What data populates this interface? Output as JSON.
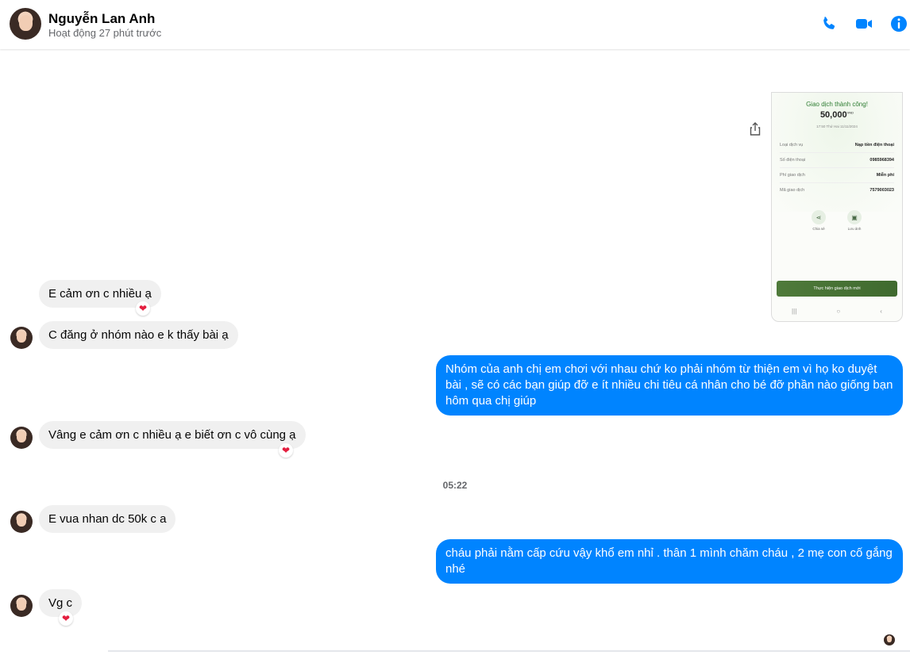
{
  "header": {
    "name": "Nguyễn Lan Anh",
    "status": "Hoạt động 27 phút trước",
    "icons": [
      "phone-icon",
      "video-icon",
      "info-icon"
    ],
    "accent_color": "#0084ff"
  },
  "transfer_image": {
    "title": "Giao dịch thành công!",
    "amount": "50,000",
    "currency": "VND",
    "time": "17:50 Thứ Hai 11/11/2024",
    "rows": [
      {
        "label": "Loại dịch vụ",
        "value": "Nạp tiền điện thoại"
      },
      {
        "label": "Số điện thoại",
        "value": "0985968394"
      },
      {
        "label": "Phí giao dịch",
        "value": "Miễn phí"
      },
      {
        "label": "Mã giao dịch",
        "value": "7579003023"
      }
    ],
    "actions": [
      "Chia sẻ",
      "Lưu ảnh"
    ],
    "button": "Thực hiện giao dịch mới"
  },
  "messages": [
    {
      "from": "them",
      "text": "E cảm ơn c nhiều ạ",
      "reaction": "❤"
    },
    {
      "from": "them",
      "text": "C đăng ở nhóm nào e k thấy bài ạ"
    },
    {
      "from": "me",
      "text": "Nhóm của anh chị em chơi với nhau chứ ko phải nhóm từ thiện em vì họ ko duyệt bài , sẽ có các bạn giúp đỡ e ít nhiều chi tiêu cá nhân cho bé đỡ phần nào giống bạn hôm qua chị giúp"
    },
    {
      "from": "them",
      "text": "Vâng e cảm ơn c nhiều ạ e biết ơn c vô cùng ạ",
      "reaction": "❤"
    },
    {
      "from": "them",
      "text": "E vua nhan dc 50k c a"
    },
    {
      "from": "me",
      "text": "cháu phải nằm cấp cứu vậy khổ em nhỉ . thân 1 mình chăm cháu , 2 mẹ con cố gắng nhé"
    },
    {
      "from": "them",
      "text": "Vg c",
      "reaction": "❤"
    }
  ],
  "time_separator": "05:22"
}
